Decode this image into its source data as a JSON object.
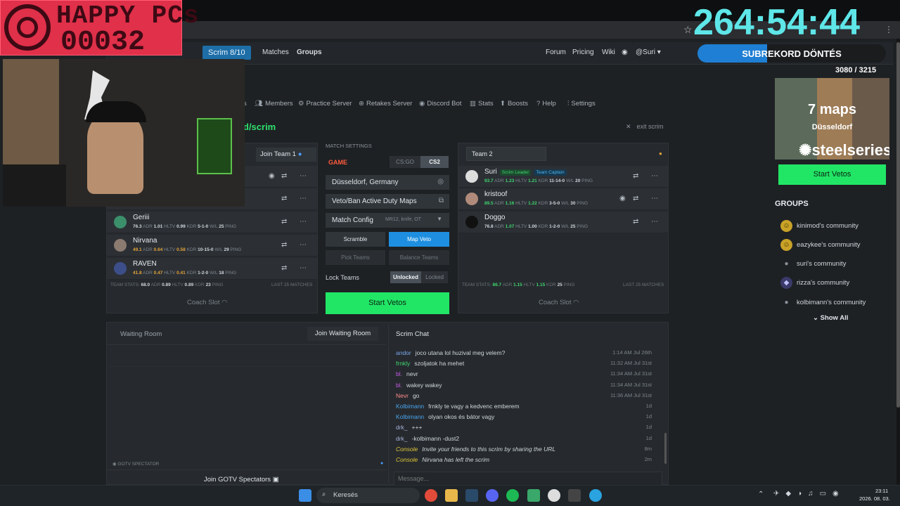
{
  "overlay": {
    "happy_title": "HAPPY PCs",
    "happy_count": "00032",
    "timer": "264:54:44",
    "sub_goal_label": "SUBREKORD DÖNTÉS",
    "sub_progress": 0.37,
    "sub_count": "3080 / 3215",
    "ad_title": "7 maps",
    "ad_subtitle": "Düsseldorf",
    "ad_brand": "steelseries"
  },
  "nav": {
    "scrim_label": "Scrim 8/10",
    "links": [
      "Matches",
      "Groups"
    ],
    "right_links": [
      "Forum",
      "Pricing",
      "Wiki"
    ],
    "user": "@Suri"
  },
  "subnav": [
    "Members",
    "Practice Server",
    "Retakes Server",
    "Discord Bot",
    "Stats",
    "Boosts",
    "Help",
    "Settings"
  ],
  "subnav_partial": "s",
  "scrim_path": "d/scrim",
  "exit_scrim": "exit scrim",
  "team1": {
    "join_label": "Join Team 1",
    "players": [
      {
        "name": "Geriii",
        "adr": "76.3",
        "hltv": "1.01",
        "kdr": "0.99",
        "wl": "5-1-0",
        "ping": "25"
      },
      {
        "name": "Nirvana",
        "adr": "49.1",
        "hltv": "0.64",
        "kdr": "0.58",
        "wl": "10-15-0",
        "ping": "29"
      },
      {
        "name": "RAVEN",
        "adr": "41.8",
        "hltv": "0.47",
        "kdr": "0.41",
        "wl": "1-2-0",
        "ping": "18"
      }
    ],
    "team_stats": {
      "label": "TEAM STATS:",
      "adr": "68.0",
      "hltv": "0.89",
      "kdr": "0.89",
      "ping": "23",
      "last": "LAST 25 MATCHES"
    },
    "coach": "Coach Slot"
  },
  "team2": {
    "name_value": "Team 2",
    "players": [
      {
        "name": "Suri",
        "tags": [
          "Scrim Leader",
          "Team Captain"
        ],
        "adr": "93.7",
        "hltv": "1.23",
        "kdr": "1.21",
        "wl": "11-14-0",
        "ping": "20"
      },
      {
        "name": "kristoof",
        "tags": [],
        "adr": "89.5",
        "hltv": "1.16",
        "kdr": "1.22",
        "wl": "3-5-0",
        "ping": "30"
      },
      {
        "name": "Doggo",
        "tags": [],
        "adr": "76.8",
        "hltv": "1.07",
        "kdr": "1.00",
        "wl": "1-2-0",
        "ping": "25"
      }
    ],
    "team_stats": {
      "label": "TEAM STATS:",
      "adr": "86.7",
      "hltv": "1.15",
      "kdr": "1.15",
      "ping": "25",
      "last": "LAST 25 MATCHES"
    },
    "coach": "Coach Slot"
  },
  "stat_labels": {
    "adr": "ADR",
    "hltv": "HLTV",
    "kdr": "KDR",
    "wl": "W/L",
    "ping": "PING"
  },
  "match_settings": {
    "label": "MATCH SETTINGS",
    "game_label": "GAME",
    "games": [
      "CS:GO",
      "CS2"
    ],
    "location": "Düsseldorf, Germany",
    "map_pool": "Veto/Ban Active Duty Maps",
    "config_label": "Match Config",
    "config_value": "MR12, knife, OT",
    "scramble": "Scramble",
    "map_veto": "Map Veto",
    "pick_teams": "Pick Teams",
    "balance_teams": "Balance Teams",
    "lock_label": "Lock Teams",
    "unlocked": "Unlocked",
    "locked": "Locked",
    "start": "Start Vetos"
  },
  "waiting_room": {
    "title": "Waiting Room",
    "join": "Join Waiting Room",
    "gotv_label": "GOTV SPECTATOR",
    "join_gotv": "Join GOTV Spectators"
  },
  "chat": {
    "title": "Scrim Chat",
    "placeholder": "Message...",
    "messages": [
      {
        "user": "andor",
        "color": "#7aa7e8",
        "text": "joco utana lol huzival meg velem?",
        "time": "1:14 AM Jul 26th",
        "italic": false
      },
      {
        "user": "frnkly",
        "color": "#3fd46f",
        "text": "szoljatok ha mehet",
        "time": "11:32 AM Jul 31st",
        "italic": false
      },
      {
        "user": "bl.",
        "color": "#c45ae6",
        "text": "nevr",
        "time": "11:34 AM Jul 31st",
        "italic": false
      },
      {
        "user": "bl.",
        "color": "#c45ae6",
        "text": "wakey wakey",
        "time": "11:34 AM Jul 31st",
        "italic": false
      },
      {
        "user": "Nevr",
        "color": "#ff8a8a",
        "text": "go",
        "time": "11:36 AM Jul 31st",
        "italic": false
      },
      {
        "user": "Kolbimann",
        "color": "#4aa3ec",
        "text": "frnkly te vagy a kedvenc emberem",
        "time": "1d",
        "italic": false
      },
      {
        "user": "Kolbimann",
        "color": "#4aa3ec",
        "text": "olyan okos és bátor vagy",
        "time": "1d",
        "italic": false
      },
      {
        "user": "drk_",
        "color": "#a8b0d8",
        "text": "+++",
        "time": "1d",
        "italic": false
      },
      {
        "user": "drk_",
        "color": "#a8b0d8",
        "text": "-kolbimann -dust2",
        "time": "1d",
        "italic": false
      },
      {
        "user": "Console",
        "color": "#e2c83a",
        "text": "Invite your friends to this scrim by sharing the URL",
        "time": "8m",
        "italic": true
      },
      {
        "user": "Console",
        "color": "#e2c83a",
        "text": "Nirvana has left the scrim",
        "time": "2m",
        "italic": true
      }
    ]
  },
  "sidebar": {
    "start_vetos": "Start Vetos",
    "groups_title": "GROUPS",
    "groups": [
      "kinimod's community",
      "eazykee's community",
      "suri's community",
      "rizza's community",
      "kolbimann's community"
    ],
    "show_all": "Show All"
  },
  "taskbar": {
    "search": "Keresés",
    "time": "23:11",
    "date": "2026. 08. 03."
  }
}
